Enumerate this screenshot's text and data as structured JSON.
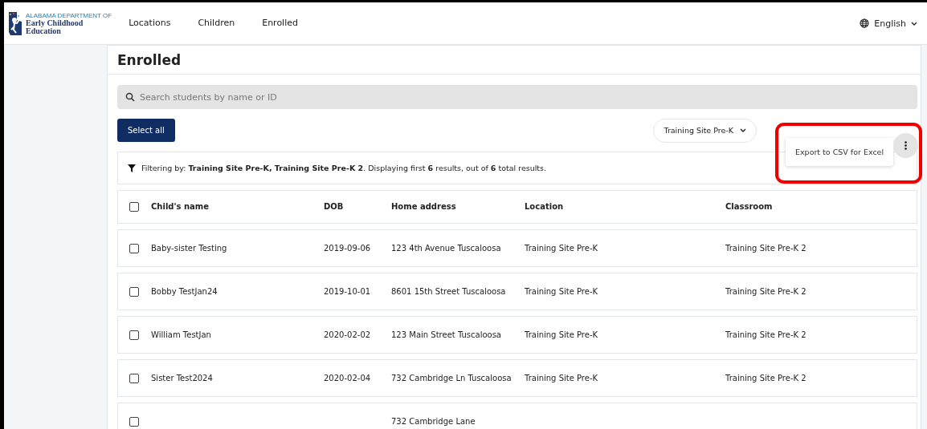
{
  "header": {
    "logo": {
      "agency": "ALABAMA DEPARTMENT OF",
      "name_line_1": "Early Childhood",
      "name_line_2": "Education"
    },
    "nav": [
      {
        "label": "Locations",
        "selected": false
      },
      {
        "label": "Children",
        "selected": false
      },
      {
        "label": "Enrolled",
        "selected": false
      }
    ],
    "language": "English"
  },
  "page": {
    "title": "Enrolled",
    "search": {
      "placeholder": "Search students by name or ID"
    },
    "select_all": "Select all",
    "location_filter": "Training Site Pre-K",
    "menu": {
      "items": [
        "Export to CSV for Excel"
      ]
    },
    "filter_summary": "Filtering by: **Training Site Pre-K, Training Site Pre-K 2**. Displaying first **6** results, out of **6** total results.",
    "table": {
      "columns": [
        "Child's name",
        "DOB",
        "Home address",
        "Location",
        "Classroom"
      ],
      "header_checked": false,
      "rows": [
        {
          "checked": false,
          "name": "Baby-sister Testing",
          "dob": "2019-09-06",
          "address": "123 4th Avenue Tuscaloosa",
          "location": "Training Site Pre-K",
          "classroom": "Training Site Pre-K 2"
        },
        {
          "checked": false,
          "name": "Bobby TestJan24",
          "dob": "2019-10-01",
          "address": "8601 15th Street Tuscaloosa",
          "location": "Training Site Pre-K",
          "classroom": "Training Site Pre-K 2"
        },
        {
          "checked": false,
          "name": "William TestJan",
          "dob": "2020-02-02",
          "address": "123 Main Street Tuscaloosa",
          "location": "Training Site Pre-K",
          "classroom": "Training Site Pre-K 2"
        },
        {
          "checked": false,
          "name": "Sister Test2024",
          "dob": "2020-02-04",
          "address": "732 Cambridge Ln Tuscaloosa",
          "location": "Training Site Pre-K",
          "classroom": "Training Site Pre-K 2"
        },
        {
          "checked": false,
          "address": "732 Cambridge Lane"
        }
      ]
    }
  },
  "annotation": {
    "kind": "highlight"
  }
}
